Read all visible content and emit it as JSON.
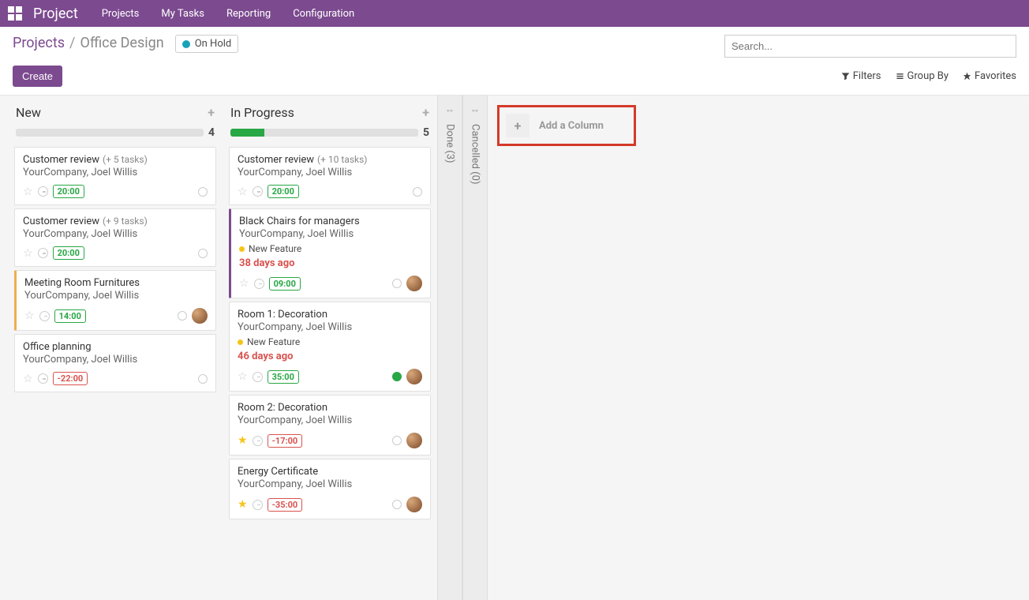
{
  "nav": {
    "brand": "Project",
    "links": [
      "Projects",
      "My Tasks",
      "Reporting",
      "Configuration"
    ]
  },
  "breadcrumb": {
    "parent": "Projects",
    "current": "Office Design"
  },
  "status": "On Hold",
  "search": {
    "placeholder": "Search..."
  },
  "buttons": {
    "create": "Create",
    "filters": "Filters",
    "groupby": "Group By",
    "favorites": "Favorites"
  },
  "addColumn": "Add a Column",
  "folded": [
    {
      "label": "Done (3)"
    },
    {
      "label": "Cancelled (0)"
    }
  ],
  "columns": [
    {
      "title": "New",
      "count": "4",
      "progressPct": 0,
      "cards": [
        {
          "title": "Customer review",
          "sub": "(+ 5 tasks)",
          "line2": "YourCompany, Joel Willis",
          "time": "20:00",
          "neg": false,
          "star": false,
          "edge": "",
          "avatar": false,
          "stateDots": 1
        },
        {
          "title": "Customer review",
          "sub": "(+ 9 tasks)",
          "line2": "YourCompany, Joel Willis",
          "time": "20:00",
          "neg": false,
          "star": false,
          "edge": "",
          "avatar": false,
          "stateDots": 1
        },
        {
          "title": "Meeting Room Furnitures",
          "sub": "",
          "line2": "YourCompany, Joel Willis",
          "time": "14:00",
          "neg": false,
          "star": false,
          "edge": "yellow",
          "avatar": true,
          "stateDots": 1
        },
        {
          "title": "Office planning",
          "sub": "",
          "line2": "YourCompany, Joel Willis",
          "time": "-22:00",
          "neg": true,
          "star": false,
          "edge": "",
          "avatar": false,
          "stateDots": 1
        }
      ]
    },
    {
      "title": "In Progress",
      "count": "5",
      "progressPct": 18,
      "cards": [
        {
          "title": "Customer review",
          "sub": "(+ 10 tasks)",
          "line2": "YourCompany, Joel Willis",
          "time": "20:00",
          "neg": false,
          "star": false,
          "edge": "",
          "avatar": false,
          "stateDots": 1
        },
        {
          "title": "Black Chairs for managers",
          "sub": "",
          "line2": "YourCompany, Joel Willis",
          "tag": "New Feature",
          "overdue": "38 days ago",
          "time": "09:00",
          "neg": false,
          "star": false,
          "edge": "purple",
          "avatar": true,
          "stateDots": 1
        },
        {
          "title": "Room 1: Decoration",
          "sub": "",
          "line2": "YourCompany, Joel Willis",
          "tag": "New Feature",
          "overdue": "46 days ago",
          "time": "35:00",
          "neg": false,
          "star": false,
          "edge": "",
          "avatar": true,
          "stateDots": 1,
          "greenDot": true
        },
        {
          "title": "Room 2: Decoration",
          "sub": "",
          "line2": "YourCompany, Joel Willis",
          "time": "-17:00",
          "neg": true,
          "star": true,
          "edge": "",
          "avatar": true,
          "stateDots": 1
        },
        {
          "title": "Energy Certificate",
          "sub": "",
          "line2": "YourCompany, Joel Willis",
          "time": "-35:00",
          "neg": true,
          "star": true,
          "edge": "",
          "avatar": true,
          "stateDots": 1
        }
      ]
    }
  ]
}
